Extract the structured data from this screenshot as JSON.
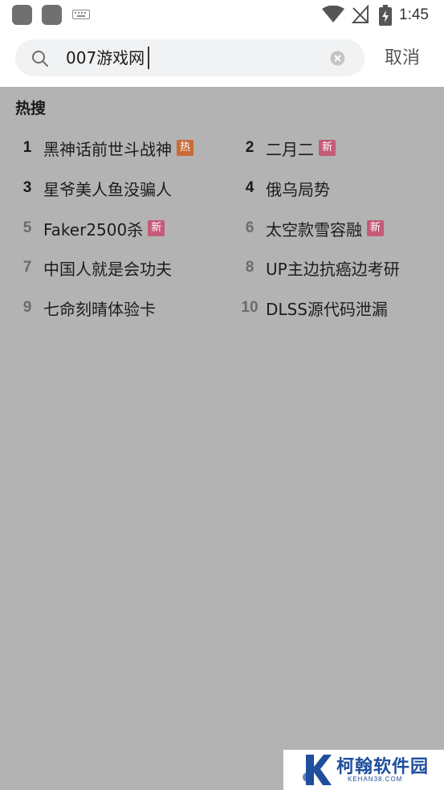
{
  "status_bar": {
    "time": "1:45",
    "icons": [
      "app-icon",
      "app-icon",
      "keyboard-icon",
      "wifi-icon",
      "no-signal-icon",
      "battery-charging-icon"
    ]
  },
  "search": {
    "value": "007游戏网",
    "icon": "search-icon",
    "clear_icon": "clear-icon",
    "cancel_label": "取消"
  },
  "hot_search": {
    "title": "热搜",
    "items": [
      {
        "rank": "1",
        "text": "黑神话前世斗战神",
        "badge": "热"
      },
      {
        "rank": "2",
        "text": "二月二",
        "badge": "新"
      },
      {
        "rank": "3",
        "text": "星爷美人鱼没骗人",
        "badge": ""
      },
      {
        "rank": "4",
        "text": "俄乌局势",
        "badge": ""
      },
      {
        "rank": "5",
        "text": "Faker2500杀",
        "badge": "新"
      },
      {
        "rank": "6",
        "text": "太空款雪容融",
        "badge": "新"
      },
      {
        "rank": "7",
        "text": "中国人就是会功夫",
        "badge": ""
      },
      {
        "rank": "8",
        "text": "UP主边抗癌边考研",
        "badge": ""
      },
      {
        "rank": "9",
        "text": "七命刻晴体验卡",
        "badge": ""
      },
      {
        "rank": "10",
        "text": "DLSS源代码泄漏",
        "badge": ""
      }
    ]
  },
  "watermark": {
    "brand": "柯翰软件园",
    "url": "KEHAN38.COM"
  },
  "colors": {
    "overlay": "#b3b3b3",
    "badge_hot": "#ca6a36",
    "badge_new": "#c55a79",
    "brand_blue": "#1f4e9c"
  }
}
